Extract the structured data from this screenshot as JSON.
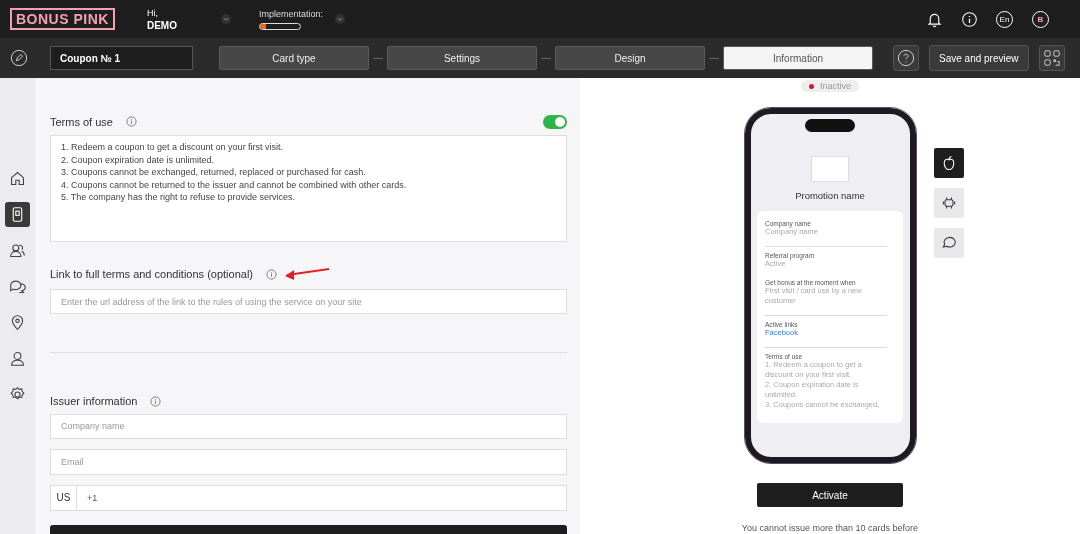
{
  "header": {
    "logo": "BONUS PINK",
    "greeting": "Hi,",
    "user": "DEMO",
    "implementation": {
      "label": "Implementation:",
      "level": 0.15
    },
    "language": "En",
    "avatar": "B"
  },
  "toolbar": {
    "coupon_name": "Coupon № 1",
    "tabs": [
      {
        "label": "Card type",
        "selected": false
      },
      {
        "label": "Settings",
        "selected": false
      },
      {
        "label": "Design",
        "selected": false
      },
      {
        "label": "Information",
        "selected": true
      }
    ],
    "save_button": "Save and preview"
  },
  "sidebar": {
    "items": [
      {
        "kind": "home",
        "selected": false
      },
      {
        "kind": "card",
        "selected": true
      },
      {
        "kind": "clients",
        "selected": false
      },
      {
        "kind": "chat",
        "selected": false
      },
      {
        "kind": "location",
        "selected": false
      },
      {
        "kind": "user",
        "selected": false
      },
      {
        "kind": "settings",
        "selected": false
      }
    ]
  },
  "terms": {
    "title": "Terms of use",
    "enabled": true,
    "lines": [
      "1. Redeem a coupon to get a discount on your first visit.",
      "2. Coupon expiration date is unlimited.",
      "3. Coupons cannot be exchanged, returned, replaced or purchased for cash.",
      "4. Coupons cannot be returned to the issuer and cannot be combined with other cards.",
      "5. The company has the right to refuse to provide services."
    ]
  },
  "link": {
    "title": "Link to full terms and conditions (optional)",
    "placeholder": "Enter the url address of the link to the rules of using the service on your site"
  },
  "issuer": {
    "title": "Issuer information",
    "company_placeholder": "Company name",
    "email_placeholder": "Email",
    "country": "US",
    "phone": "+1"
  },
  "preview": {
    "status": "Inactive",
    "platforms": [
      {
        "kind": "apple",
        "selected": true
      },
      {
        "kind": "android",
        "selected": false
      },
      {
        "kind": "chat",
        "selected": false
      }
    ],
    "promotion_name": "Promotion name",
    "fields": [
      {
        "kind": "text",
        "label": "Company name",
        "value": "Company name"
      },
      {
        "kind": "text",
        "label": "Referral program",
        "value": "Active",
        "extra_label": "Get bonus at the moment when",
        "extra_value": "First visit / card use by a new customer"
      },
      {
        "kind": "link",
        "label": "Active links",
        "value": "Facebook"
      }
    ],
    "terms_label": "Terms of use",
    "terms_lines": [
      "1. Redeem a coupon to get a discount on your first visit.",
      "2. Coupon expiration date is unlimited.",
      "3. Coupons cannot be exchanged,"
    ],
    "activate": "Activate",
    "note": "You cannot issue more than 10 cards before"
  }
}
